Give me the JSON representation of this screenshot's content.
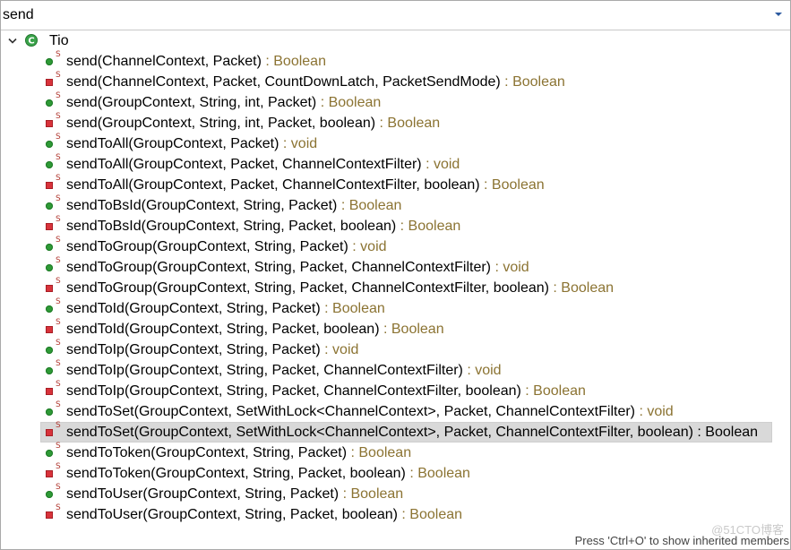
{
  "search": {
    "value": "send",
    "placeholder": ""
  },
  "tree": {
    "root_label": "Tio",
    "root_icon": "class-icon",
    "methods": [
      {
        "sig": "send(ChannelContext, Packet)",
        "ret": " : Boolean",
        "visibility": "public"
      },
      {
        "sig": "send(ChannelContext, Packet, CountDownLatch, PacketSendMode)",
        "ret": " : Boolean",
        "visibility": "private"
      },
      {
        "sig": "send(GroupContext, String, int, Packet)",
        "ret": " : Boolean",
        "visibility": "public"
      },
      {
        "sig": "send(GroupContext, String, int, Packet, boolean)",
        "ret": " : Boolean",
        "visibility": "private"
      },
      {
        "sig": "sendToAll(GroupContext, Packet)",
        "ret": " : void",
        "visibility": "public"
      },
      {
        "sig": "sendToAll(GroupContext, Packet, ChannelContextFilter)",
        "ret": " : void",
        "visibility": "public"
      },
      {
        "sig": "sendToAll(GroupContext, Packet, ChannelContextFilter, boolean)",
        "ret": " : Boolean",
        "visibility": "private"
      },
      {
        "sig": "sendToBsId(GroupContext, String, Packet)",
        "ret": " : Boolean",
        "visibility": "public"
      },
      {
        "sig": "sendToBsId(GroupContext, String, Packet, boolean)",
        "ret": " : Boolean",
        "visibility": "private"
      },
      {
        "sig": "sendToGroup(GroupContext, String, Packet)",
        "ret": " : void",
        "visibility": "public"
      },
      {
        "sig": "sendToGroup(GroupContext, String, Packet, ChannelContextFilter)",
        "ret": " : void",
        "visibility": "public"
      },
      {
        "sig": "sendToGroup(GroupContext, String, Packet, ChannelContextFilter, boolean)",
        "ret": " : Boolean",
        "visibility": "private"
      },
      {
        "sig": "sendToId(GroupContext, String, Packet)",
        "ret": " : Boolean",
        "visibility": "public"
      },
      {
        "sig": "sendToId(GroupContext, String, Packet, boolean)",
        "ret": " : Boolean",
        "visibility": "private"
      },
      {
        "sig": "sendToIp(GroupContext, String, Packet)",
        "ret": " : void",
        "visibility": "public"
      },
      {
        "sig": "sendToIp(GroupContext, String, Packet, ChannelContextFilter)",
        "ret": " : void",
        "visibility": "public"
      },
      {
        "sig": "sendToIp(GroupContext, String, Packet, ChannelContextFilter, boolean)",
        "ret": " : Boolean",
        "visibility": "private"
      },
      {
        "sig": "sendToSet(GroupContext, SetWithLock<ChannelContext>, Packet, ChannelContextFilter)",
        "ret": " : void",
        "visibility": "public"
      },
      {
        "sig": "sendToSet(GroupContext, SetWithLock<ChannelContext>, Packet, ChannelContextFilter, boolean)",
        "ret": " : Boolean",
        "visibility": "private",
        "selected": true
      },
      {
        "sig": "sendToToken(GroupContext, String, Packet)",
        "ret": " : Boolean",
        "visibility": "public"
      },
      {
        "sig": "sendToToken(GroupContext, String, Packet, boolean)",
        "ret": " : Boolean",
        "visibility": "private"
      },
      {
        "sig": "sendToUser(GroupContext, String, Packet)",
        "ret": " : Boolean",
        "visibility": "public"
      },
      {
        "sig": "sendToUser(GroupContext, String, Packet, boolean)",
        "ret": " : Boolean",
        "visibility": "private"
      }
    ],
    "static_marker": "S"
  },
  "status": {
    "hint": "Press 'Ctrl+O' to show inherited members"
  },
  "watermark": "@51CTO博客",
  "colors": {
    "return_type": "#8b7332",
    "public_icon": "#2e9a36",
    "private_icon": "#d8333b",
    "selection": "#d9d9d9"
  }
}
